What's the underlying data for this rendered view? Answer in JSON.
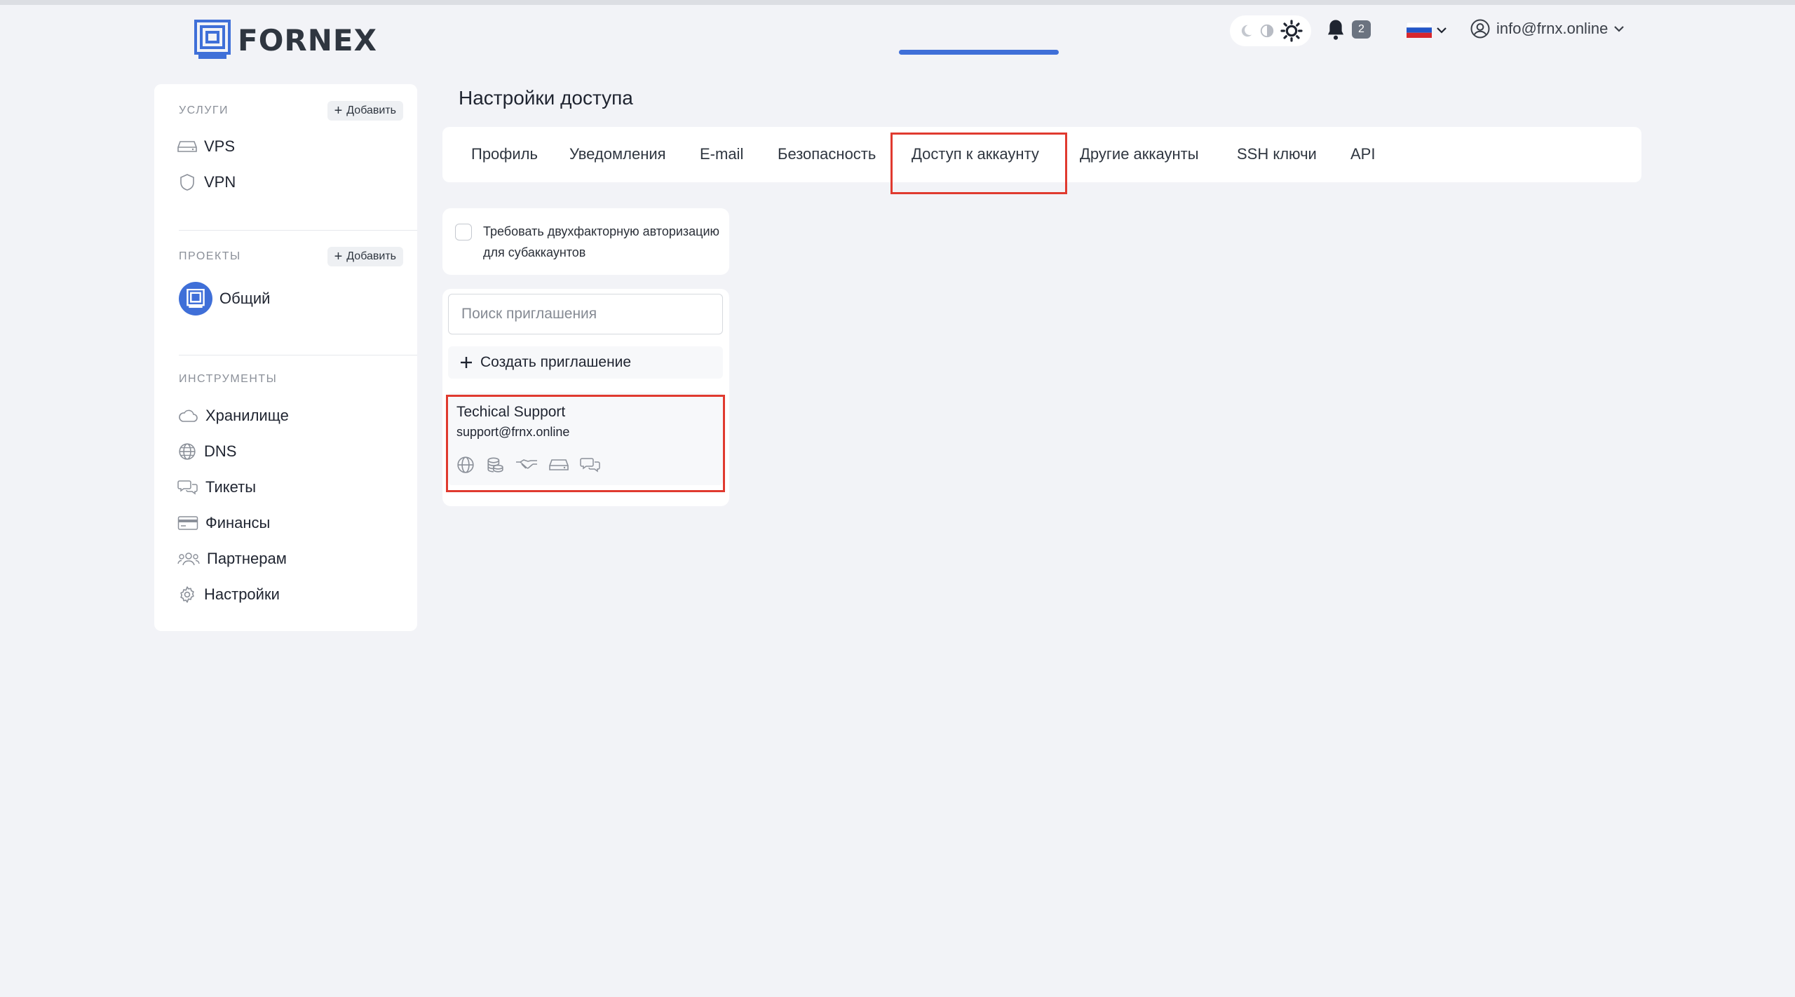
{
  "header": {
    "logo_text": "FORNEX",
    "notifications_count": "2",
    "language": "ru",
    "user_email": "info@frnx.online"
  },
  "sidebar": {
    "services": {
      "title": "УСЛУГИ",
      "add_label": "Добавить",
      "items": [
        {
          "label": "VPS",
          "icon": "server-icon"
        },
        {
          "label": "VPN",
          "icon": "shield-icon"
        }
      ]
    },
    "projects": {
      "title": "ПРОЕКТЫ",
      "add_label": "Добавить",
      "items": [
        {
          "label": "Общий",
          "icon": "project-avatar-icon"
        }
      ]
    },
    "tools": {
      "title": "ИНСТРУМЕНТЫ",
      "items": [
        {
          "label": "Хранилище",
          "icon": "cloud-icon"
        },
        {
          "label": "DNS",
          "icon": "globe-icon"
        },
        {
          "label": "Тикеты",
          "icon": "chat-icon"
        },
        {
          "label": "Финансы",
          "icon": "card-icon"
        },
        {
          "label": "Партнерам",
          "icon": "users-icon"
        },
        {
          "label": "Настройки",
          "icon": "gear-icon"
        }
      ]
    }
  },
  "main": {
    "title": "Настройки доступа",
    "tabs": [
      {
        "label": "Профиль"
      },
      {
        "label": "Уведомления"
      },
      {
        "label": "E-mail"
      },
      {
        "label": "Безопасность"
      },
      {
        "label": "Доступ к аккаунту",
        "active": true
      },
      {
        "label": "Другие аккаунты"
      },
      {
        "label": "SSH ключи"
      },
      {
        "label": "API"
      }
    ],
    "twofa": {
      "label": "Требовать двухфакторную авторизацию для субаккаунтов",
      "checked": false
    },
    "invitations": {
      "search_placeholder": "Поиск приглашения",
      "create_label": "Создать приглашение",
      "items": [
        {
          "name": "Techical Support",
          "email": "support@frnx.online",
          "permission_icons": [
            "globe-icon",
            "coins-icon",
            "handshake-icon",
            "server-icon",
            "chat-icon"
          ]
        }
      ]
    }
  },
  "colors": {
    "accent": "#3f6fd8",
    "highlight": "#e03a2f",
    "background": "#f2f3f7"
  }
}
